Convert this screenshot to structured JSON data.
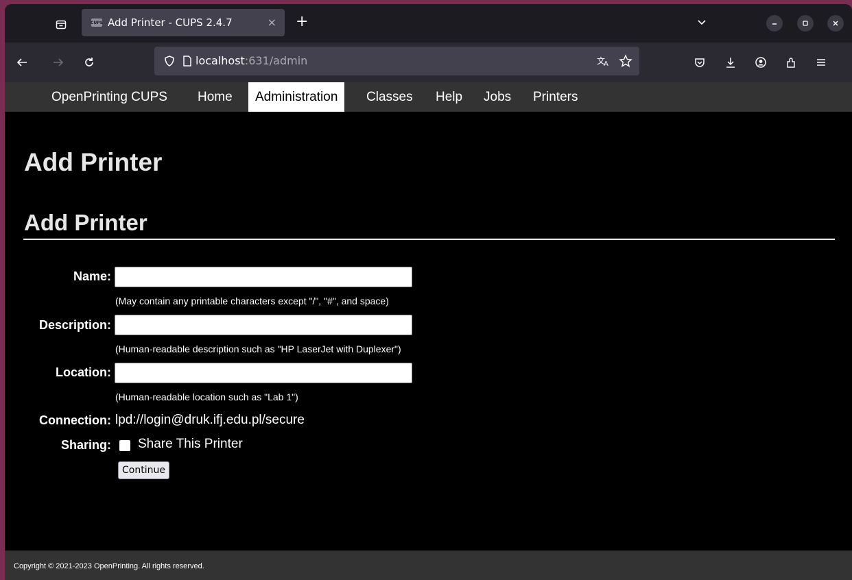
{
  "browser": {
    "tab_title": "Add Printer - CUPS 2.4.7",
    "favicon_text": "CUPS",
    "tab_close": "×",
    "new_tab": "+",
    "url_host": "localhost",
    "url_path": ":631/admin"
  },
  "nav": {
    "items": [
      {
        "label": "OpenPrinting CUPS"
      },
      {
        "label": "Home"
      },
      {
        "label": "Administration",
        "active": true
      },
      {
        "label": "Classes"
      },
      {
        "label": "Help"
      },
      {
        "label": "Jobs"
      },
      {
        "label": "Printers"
      }
    ]
  },
  "page": {
    "title": "Add Printer",
    "section_title": "Add Printer"
  },
  "form": {
    "name_label": "Name:",
    "name_value": "",
    "name_hint": "(May contain any printable characters except \"/\", \"#\", and space)",
    "description_label": "Description:",
    "description_value": "",
    "description_hint": "(Human-readable description such as \"HP LaserJet with Duplexer\")",
    "location_label": "Location:",
    "location_value": "",
    "location_hint": "(Human-readable location such as \"Lab 1\")",
    "connection_label": "Connection:",
    "connection_value": "lpd://login@druk.ifj.edu.pl/secure",
    "sharing_label": "Sharing:",
    "sharing_option": "Share This Printer",
    "sharing_checked": false,
    "continue_label": "Continue"
  },
  "footer": {
    "text": "Copyright © 2021-2023 OpenPrinting. All rights reserved."
  },
  "colors": {
    "nav_bg": "#333333",
    "page_bg": "#000000",
    "heading": "#e6e6e6",
    "browser_chrome": "#1c1b22",
    "toolbar": "#2b2a33",
    "urlbar": "#42414d"
  }
}
